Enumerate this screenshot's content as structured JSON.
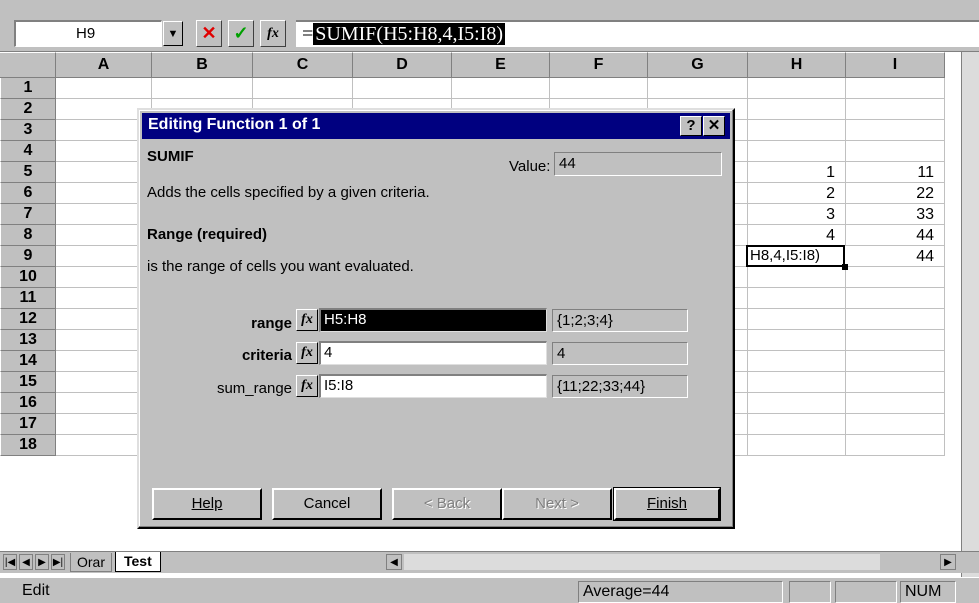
{
  "formula_bar": {
    "cell_ref": "H9",
    "dropdown_glyph": "▼",
    "cancel_glyph": "✕",
    "enter_glyph": "✓",
    "function_glyph": "fx",
    "equals": "=",
    "formula": "SUMIF(H5:H8,4,I5:I8)"
  },
  "columns": [
    "A",
    "B",
    "C",
    "D",
    "E",
    "F",
    "G",
    "H",
    "I"
  ],
  "rows": [
    "1",
    "2",
    "3",
    "4",
    "5",
    "6",
    "7",
    "8",
    "9",
    "10",
    "11",
    "12",
    "13",
    "14",
    "15",
    "16",
    "17",
    "18"
  ],
  "cells": {
    "H5": "1",
    "I5": "11",
    "H6": "2",
    "I6": "22",
    "H7": "3",
    "I7": "33",
    "H8": "4",
    "I8": "44",
    "H9": "H8,4,I5:I8)",
    "I9": "44"
  },
  "dialog": {
    "title": "Editing Function 1 of 1",
    "help_glyph": "?",
    "close_glyph": "✕",
    "function_name": "SUMIF",
    "value_label": "Value:",
    "value": "44",
    "description": "Adds the cells specified by a given criteria.",
    "arg_title": "Range (required)",
    "arg_description": "is the range of cells you want evaluated.",
    "args": [
      {
        "label": "range",
        "input": "H5:H8",
        "result": "{1;2;3;4}"
      },
      {
        "label": "criteria",
        "input": "4",
        "result": "4"
      },
      {
        "label": "sum_range",
        "input": "I5:I8",
        "result": "{11;22;33;44}"
      }
    ],
    "fx_glyph": "fx",
    "buttons": {
      "help": "Help",
      "cancel": "Cancel",
      "back": "< Back",
      "next": "Next >",
      "finish": "Finish"
    }
  },
  "sheet_tabs": {
    "nav": [
      "|◀",
      "◀",
      "▶",
      "▶|"
    ],
    "tabs": [
      "Orar",
      "Test"
    ],
    "active": "Test"
  },
  "status_bar": {
    "mode": "Edit",
    "sum_text": "Average=44",
    "num_indicator": "NUM"
  }
}
